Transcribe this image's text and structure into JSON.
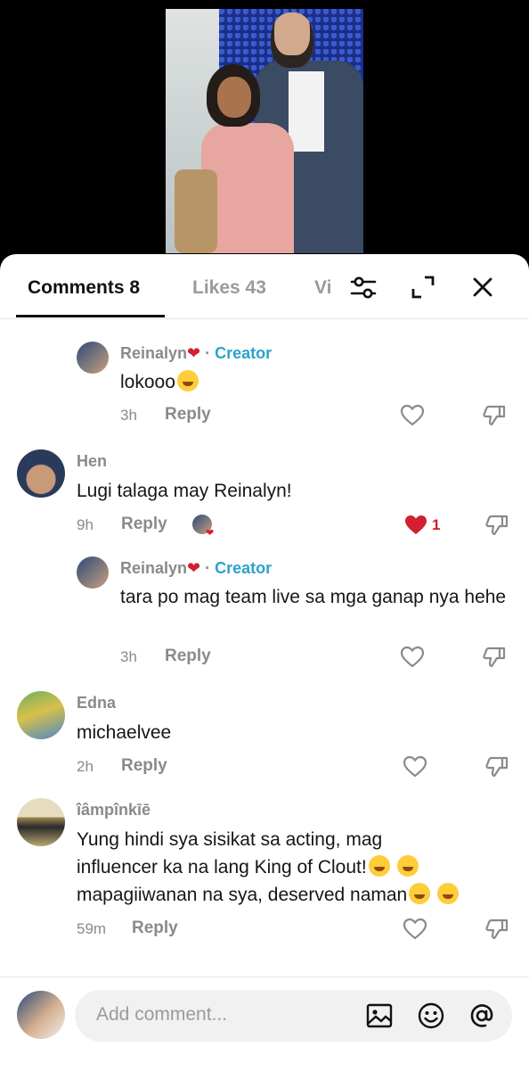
{
  "tabs": [
    {
      "label": "Comments 8",
      "active": true
    },
    {
      "label": "Likes 43",
      "active": false
    },
    {
      "label": "Vi",
      "active": false
    }
  ],
  "header_icons": [
    "filter-sliders-icon",
    "collapse-icon",
    "close-icon"
  ],
  "comments": [
    {
      "username": "Reinalyn",
      "badge": "Creator",
      "text": "lokooo",
      "time": "3h",
      "reply_label": "Reply",
      "is_reply": true
    },
    {
      "username": "Hen",
      "badge": "",
      "text": "Lugi talaga may Reinalyn!",
      "time": "9h",
      "reply_label": "Reply",
      "likes": "1",
      "liked_by_creator": true,
      "is_reply": false
    },
    {
      "username": "Reinalyn",
      "badge": "Creator",
      "text": "tara po mag team live sa mga ganap nya hehe",
      "time": "3h",
      "reply_label": "Reply",
      "is_reply": true
    },
    {
      "username": "Edna",
      "badge": "",
      "text": "michaelvee",
      "time": "2h",
      "reply_label": "Reply",
      "is_reply": false
    },
    {
      "username": "îâmpînkīē",
      "badge": "",
      "text_lines": [
        "Yung hindi sya sisikat sa acting, mag",
        "influencer ka na lang King of Clout!",
        "mapagiiwanan na sya, deserved naman"
      ],
      "time": "59m",
      "reply_label": "Reply",
      "is_reply": false
    }
  ],
  "separator": "·",
  "footer": {
    "placeholder": "Add comment..."
  },
  "colors": {
    "accent_creator": "#2aa3c9",
    "like_red": "#d1202e",
    "muted": "#8a8a8a"
  }
}
